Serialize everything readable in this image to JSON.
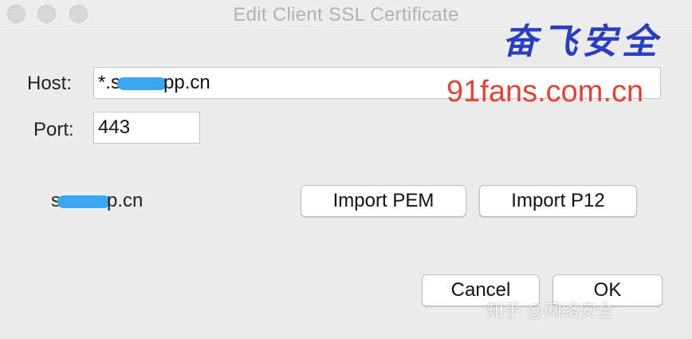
{
  "window": {
    "title": "Edit Client SSL Certificate"
  },
  "form": {
    "host_label": "Host:",
    "host_value_prefix": "*.s",
    "host_value_suffix": "pp.cn",
    "port_label": "Port:",
    "port_value": "443"
  },
  "certificate": {
    "domain_prefix": "s",
    "domain_suffix": "p.cn"
  },
  "buttons": {
    "import_pem": "Import PEM",
    "import_p12": "Import P12",
    "cancel": "Cancel",
    "ok": "OK"
  },
  "watermarks": {
    "cn_text": "奋飞安全",
    "url_text": "91fans.com.cn",
    "zhihu_text": "知乎 @网络安全",
    "colors": {
      "cn": "#2a3fbf",
      "url": "#e0433a"
    }
  },
  "colors": {
    "redaction": "#3aa6f2",
    "window_bg": "#ececec"
  }
}
